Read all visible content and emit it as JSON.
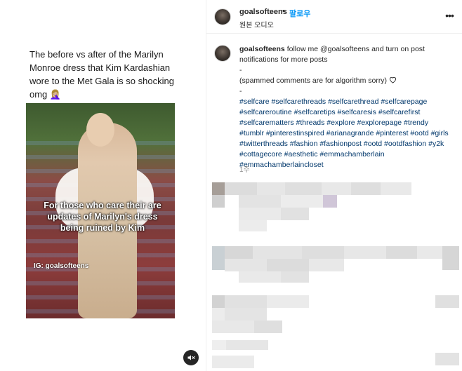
{
  "media": {
    "tweet_text": "The before vs after of the Marilyn Monroe dress that Kim Kardashian wore to the Met Gala is so shocking omg 🤦🏼‍♀️",
    "overlay_caption": "For those who care their are updates of Marilyn's dress being ruined by Kim",
    "watermark": "IG: goalsofteens",
    "mute_icon": "mute-icon"
  },
  "header": {
    "username": "goalsofteens",
    "separator": "•",
    "follow_label": "팔로우",
    "audio_label": "원본 오디오",
    "more_icon": "more-options-icon"
  },
  "post": {
    "username": "goalsofteens",
    "caption_intro": "follow me @goalsofteens and turn on post notifications for more posts",
    "dash1": "-",
    "spam_note": "(spammed comments are for algorithm sorry)",
    "dash2": "-",
    "hashtags": "#selfcare #selfcarethreads #selfcarethread #selfcarepage #selfcareroutine #selfcaretips #selfcaresis #selfcarefirst #selfcarematters #threads #explore #explorepage #trendy #tumblr #pinterestinspired #arianagrande #pinterest #ootd #girls #twitterthreads #fashion #fashionpost #ootd #ootdfashion #y2k #cottagecore #aesthetic #emmachamberlain #emmachamberlaincloset",
    "timestamp": "1주"
  },
  "colors": {
    "link_blue": "#0095f6",
    "hashtag_blue": "#00376b",
    "muted_gray": "#8e8e8e",
    "divider": "#efefef"
  }
}
